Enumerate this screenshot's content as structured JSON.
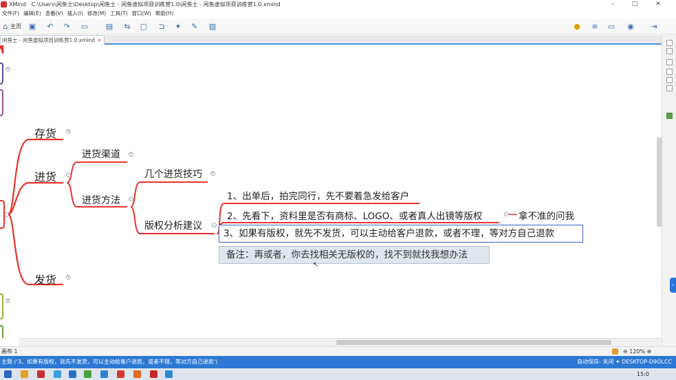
{
  "window": {
    "app_name": "XMind",
    "title": "C:\\Users\\闲鱼士\\Desktop\\闲鱼士 - 闲鱼虚拟项目训练营1.0\\闲鱼士 - 闲鱼虚拟项目训练营1.0.xmind"
  },
  "menu": {
    "items": [
      "文件(F)",
      "编辑(E)",
      "查看(V)",
      "插入(I)",
      "修改(M)",
      "工具(T)",
      "窗口(W)",
      "帮助(H)"
    ]
  },
  "toolbar": {
    "home_label": "主页"
  },
  "tab": {
    "label": "闲鱼士 - 闲鱼虚拟项目训练营1.0.xmind",
    "close_glyph": "×"
  },
  "mindmap": {
    "topics": {
      "cunhuo": "存货",
      "jinhuo": "进货",
      "fahuo": "发货",
      "jinhuo_qudao": "进货渠道",
      "jinhuo_fangfa": "进货方法",
      "jige_jiqiao": "几个进货技巧",
      "banquan_jianyi": "版权分析建议",
      "item1": "1、出单后，拍完同行，先不要着急发给客户",
      "item2": "2、先看下，资料里是否有商标、LOGO、或者真人出镜等版权",
      "item2_side": "拿不准的问我",
      "item3": "3、如果有版权，就先不发货，可以主动给客户退款，或者不理，等对方自己退款",
      "note": "备注：再或者，你去找相关无版权的，找不到就找我想办法"
    },
    "colors": {
      "red": "#e8332d",
      "purple": "#5a4a9a",
      "sel_blue": "#3c60c8"
    }
  },
  "footer": {
    "sheet_label": "画布 1",
    "zoom": "120%"
  },
  "status": {
    "message": "主题 ('3、如果有版权，就先不发货，可以主动给客户退款，或者不理，等对方自己退款')",
    "info": "自动保存: 关闭  ✦ DESKTOP-D9OLCC"
  },
  "taskbar": {
    "time": "15:0"
  }
}
